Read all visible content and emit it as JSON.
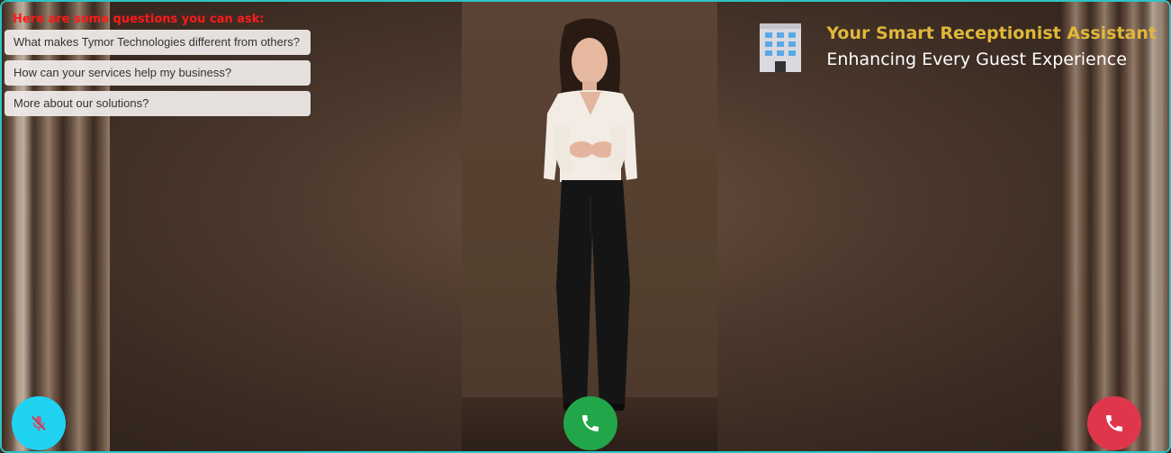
{
  "questions": {
    "heading": "Here are some questions you can ask:",
    "items": [
      {
        "label": "What makes Tymor Technologies different from others?"
      },
      {
        "label": "How can your services help my business?"
      },
      {
        "label": "More about our solutions?"
      }
    ]
  },
  "brand": {
    "title": "Your Smart Receptionist Assistant",
    "subtitle": "Enhancing Every Guest Experience",
    "icon": "office-building-icon"
  },
  "controls": {
    "mute": {
      "icon": "microphone-off-icon",
      "color": "#1fd3f0"
    },
    "call": {
      "icon": "phone-icon",
      "color": "#22a64a"
    },
    "end_call": {
      "icon": "phone-icon",
      "color": "#e0364c"
    }
  },
  "colors": {
    "heading": "#ff1a1a",
    "brand_title": "#e0b73a",
    "frame_border": "#2ec4c4"
  }
}
